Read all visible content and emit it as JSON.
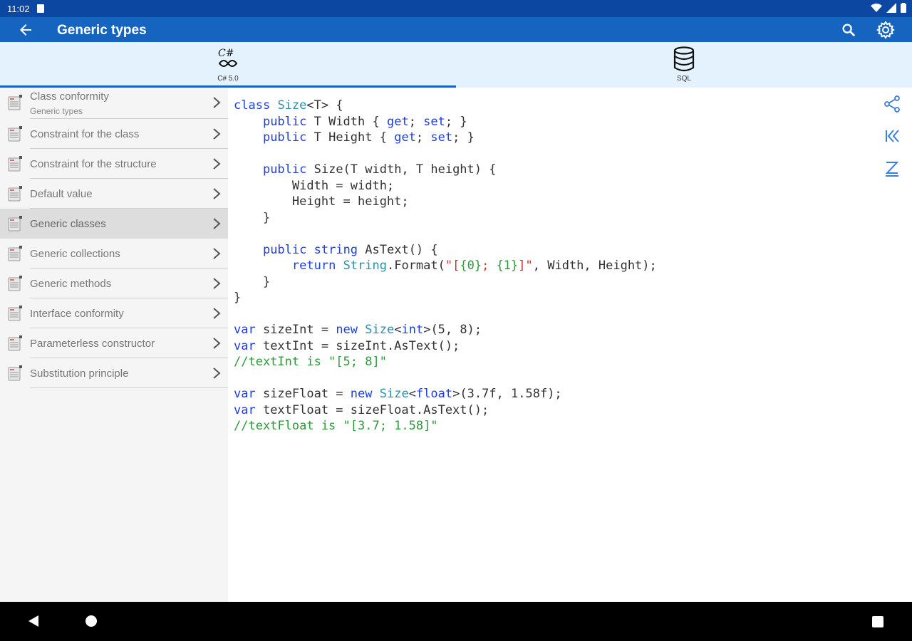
{
  "status": {
    "time": "11:02"
  },
  "appbar": {
    "title": "Generic types"
  },
  "tabs": [
    {
      "label": "C# 5.0",
      "icon": "csharp-icon",
      "active": true
    },
    {
      "label": "SQL",
      "icon": "database-icon",
      "active": false
    }
  ],
  "sidebar": {
    "items": [
      {
        "label": "Class conformity",
        "sub": "Generic types"
      },
      {
        "label": "Constraint for the class"
      },
      {
        "label": "Constraint for the structure"
      },
      {
        "label": "Default value"
      },
      {
        "label": "Generic classes",
        "selected": true
      },
      {
        "label": "Generic collections"
      },
      {
        "label": "Generic methods"
      },
      {
        "label": "Interface conformity"
      },
      {
        "label": "Parameterless constructor"
      },
      {
        "label": "Substitution principle"
      }
    ]
  },
  "code": {
    "lines": [
      [
        [
          "kw",
          "class"
        ],
        [
          "t",
          " "
        ],
        [
          "ty",
          "Size"
        ],
        [
          "t",
          "<T> {"
        ]
      ],
      [
        [
          "t",
          "    "
        ],
        [
          "kw",
          "public"
        ],
        [
          "t",
          " T Width { "
        ],
        [
          "kw",
          "get"
        ],
        [
          "t",
          "; "
        ],
        [
          "kw",
          "set"
        ],
        [
          "t",
          "; }"
        ]
      ],
      [
        [
          "t",
          "    "
        ],
        [
          "kw",
          "public"
        ],
        [
          "t",
          " T Height { "
        ],
        [
          "kw",
          "get"
        ],
        [
          "t",
          "; "
        ],
        [
          "kw",
          "set"
        ],
        [
          "t",
          "; }"
        ]
      ],
      [
        [
          "t",
          ""
        ]
      ],
      [
        [
          "t",
          "    "
        ],
        [
          "kw",
          "public"
        ],
        [
          "t",
          " Size(T width, T height) {"
        ]
      ],
      [
        [
          "t",
          "        Width = width;"
        ]
      ],
      [
        [
          "t",
          "        Height = height;"
        ]
      ],
      [
        [
          "t",
          "    }"
        ]
      ],
      [
        [
          "t",
          ""
        ]
      ],
      [
        [
          "t",
          "    "
        ],
        [
          "kw",
          "public"
        ],
        [
          "t",
          " "
        ],
        [
          "kw",
          "string"
        ],
        [
          "t",
          " AsText() {"
        ]
      ],
      [
        [
          "t",
          "        "
        ],
        [
          "kw",
          "return"
        ],
        [
          "t",
          " "
        ],
        [
          "ty",
          "String"
        ],
        [
          "t",
          ".Format("
        ],
        [
          "str",
          "\"["
        ],
        [
          "ph",
          "{0}"
        ],
        [
          "str",
          "; "
        ],
        [
          "ph",
          "{1}"
        ],
        [
          "str",
          "]\""
        ],
        [
          "t",
          ", Width, Height);"
        ]
      ],
      [
        [
          "t",
          "    }"
        ]
      ],
      [
        [
          "t",
          "}"
        ]
      ],
      [
        [
          "t",
          ""
        ]
      ],
      [
        [
          "kw",
          "var"
        ],
        [
          "t",
          " sizeInt = "
        ],
        [
          "kw",
          "new"
        ],
        [
          "t",
          " "
        ],
        [
          "ty",
          "Size"
        ],
        [
          "t",
          "<"
        ],
        [
          "kw",
          "int"
        ],
        [
          "t",
          ">(5, 8);"
        ]
      ],
      [
        [
          "kw",
          "var"
        ],
        [
          "t",
          " textInt = sizeInt.AsText();"
        ]
      ],
      [
        [
          "cm",
          "//textInt is \"[5; 8]\""
        ]
      ],
      [
        [
          "t",
          ""
        ]
      ],
      [
        [
          "kw",
          "var"
        ],
        [
          "t",
          " sizeFloat = "
        ],
        [
          "kw",
          "new"
        ],
        [
          "t",
          " "
        ],
        [
          "ty",
          "Size"
        ],
        [
          "t",
          "<"
        ],
        [
          "kw",
          "float"
        ],
        [
          "t",
          ">(3.7f, 1.58f);"
        ]
      ],
      [
        [
          "kw",
          "var"
        ],
        [
          "t",
          " textFloat = sizeFloat.AsText();"
        ]
      ],
      [
        [
          "cm",
          "//textFloat is \"[3.7; 1.58]\""
        ]
      ]
    ]
  },
  "colors": {
    "appbar": "#1565c0",
    "statusbar": "#0c47a1",
    "tabbar": "#e3f2fd",
    "keyword": "#1e3ee0",
    "type": "#2b8fa8",
    "string": "#c8342c",
    "comment": "#2e9a3a"
  }
}
